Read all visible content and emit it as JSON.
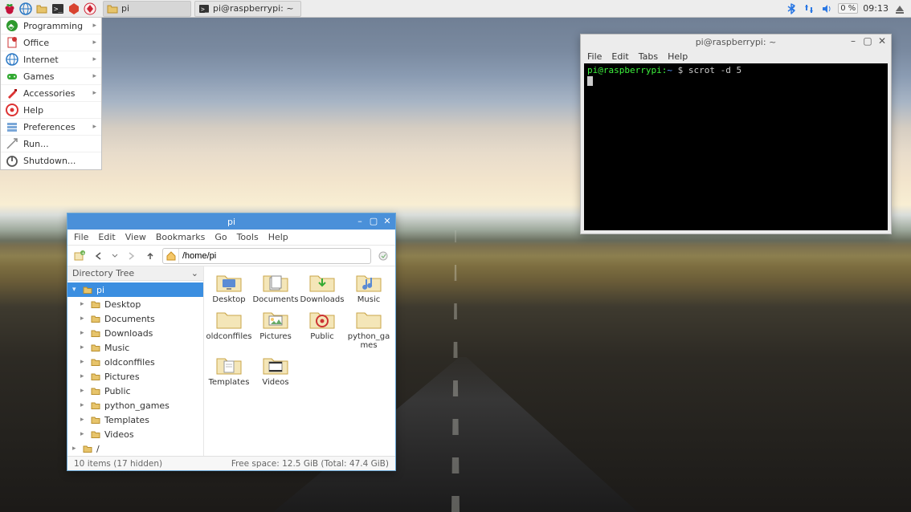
{
  "panel": {
    "tasks": [
      {
        "label": "pi"
      },
      {
        "label": "pi@raspberrypi: ~"
      }
    ],
    "tray": {
      "cpu": "0 %",
      "clock": "09:13"
    }
  },
  "appmenu": [
    {
      "icon": "code",
      "label": "Programming",
      "sub": true
    },
    {
      "icon": "office",
      "label": "Office",
      "sub": true
    },
    {
      "icon": "globe",
      "label": "Internet",
      "sub": true
    },
    {
      "icon": "games",
      "label": "Games",
      "sub": true
    },
    {
      "icon": "acc",
      "label": "Accessories",
      "sub": true
    },
    {
      "icon": "help",
      "label": "Help",
      "sub": false
    },
    {
      "icon": "prefs",
      "label": "Preferences",
      "sub": true
    },
    {
      "icon": "run",
      "label": "Run...",
      "sub": false
    },
    {
      "icon": "power",
      "label": "Shutdown...",
      "sub": false
    }
  ],
  "fm": {
    "title": "pi",
    "menubar": [
      "File",
      "Edit",
      "View",
      "Bookmarks",
      "Go",
      "Tools",
      "Help"
    ],
    "path": "/home/pi",
    "tree_header": "Directory Tree",
    "tree_root": {
      "label": "pi"
    },
    "tree_children": [
      "Desktop",
      "Documents",
      "Downloads",
      "Music",
      "oldconffiles",
      "Pictures",
      "Public",
      "python_games",
      "Templates",
      "Videos"
    ],
    "tree_root2": "/",
    "folders": [
      {
        "label": "Desktop",
        "emblem": "desktop"
      },
      {
        "label": "Documents",
        "emblem": "docs"
      },
      {
        "label": "Downloads",
        "emblem": "down"
      },
      {
        "label": "Music",
        "emblem": "music"
      },
      {
        "label": "oldconffiles",
        "emblem": ""
      },
      {
        "label": "Pictures",
        "emblem": "pic"
      },
      {
        "label": "Public",
        "emblem": "public"
      },
      {
        "label": "python_games",
        "emblem": ""
      },
      {
        "label": "Templates",
        "emblem": "tpl"
      },
      {
        "label": "Videos",
        "emblem": "vid"
      }
    ],
    "status_left": "10 items (17 hidden)",
    "status_right": "Free space: 12.5 GiB (Total: 47.4 GiB)"
  },
  "term": {
    "title": "pi@raspberrypi: ~",
    "menubar": [
      "File",
      "Edit",
      "Tabs",
      "Help"
    ],
    "prompt_user": "pi@raspberrypi",
    "prompt_path": "~",
    "prompt_sep": "$",
    "command": "scrot -d 5"
  }
}
